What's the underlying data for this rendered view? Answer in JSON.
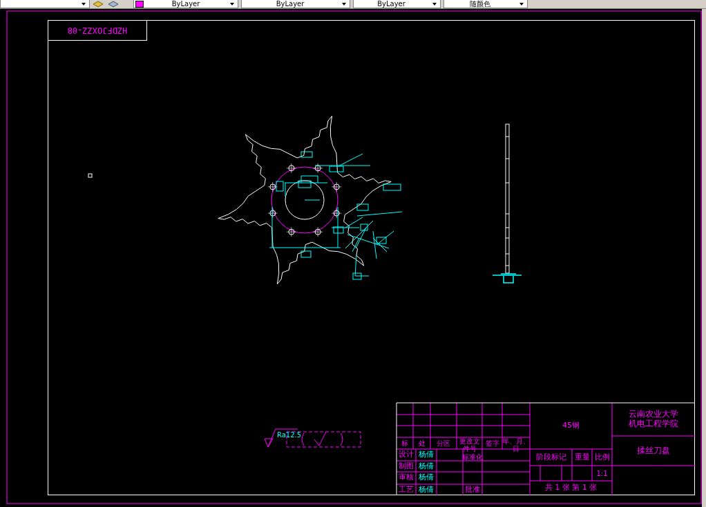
{
  "toolbar": {
    "fields": [
      {
        "value": "ByLayer",
        "color": "#ff00ff"
      },
      {
        "value": "ByLayer"
      },
      {
        "value": "ByLayer"
      },
      {
        "value": "随颜色"
      }
    ]
  },
  "drawing_number": "HZDFJOXZZ-08",
  "surface_finish": {
    "roughness": "Ra12.5"
  },
  "title_block": {
    "material": "45钢",
    "school": [
      "云南农业大学",
      "机电工程学院"
    ],
    "part_name": "揉丝刀盘",
    "headers": [
      "标",
      "处",
      "分区",
      "更改文件号",
      "签字",
      "年、月、日"
    ],
    "signers": [
      {
        "role": "设计",
        "name": "杨倩"
      },
      {
        "role": "制图",
        "name": "杨倩"
      },
      {
        "role": "审核",
        "name": "杨倩"
      },
      {
        "role": "工艺",
        "name": "杨倩"
      }
    ],
    "standardization": "标准化",
    "approval": "批准",
    "stage_mark": "阶段标记",
    "weight": "重量",
    "scale_label": "比例",
    "scale": "1:1",
    "sheets": "共 1 张  第 1 张"
  }
}
